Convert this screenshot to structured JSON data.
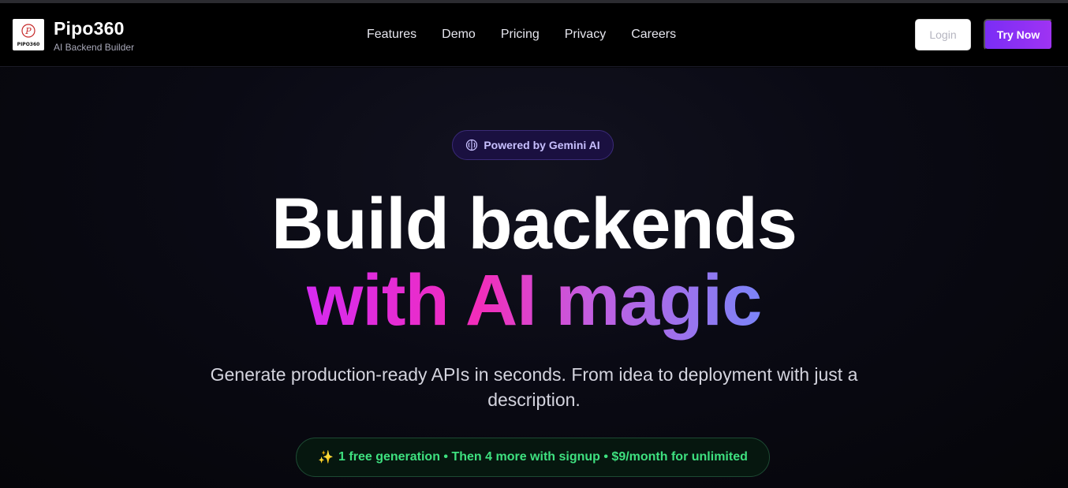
{
  "header": {
    "brand_name": "Pipo360",
    "brand_tagline": "AI Backend Builder",
    "logo_text": "PIPO360",
    "nav": [
      {
        "label": "Features"
      },
      {
        "label": "Demo"
      },
      {
        "label": "Pricing"
      },
      {
        "label": "Privacy"
      },
      {
        "label": "Careers"
      }
    ],
    "login_label": "Login",
    "try_label": "Try Now"
  },
  "hero": {
    "badge_label": "Powered by Gemini AI",
    "badge_icon": "brain-icon",
    "title_line1": "Build backends",
    "title_line2": "with AI magic",
    "description": "Generate production-ready APIs in seconds. From idea to deployment with just a description.",
    "offer_icon": "✨",
    "offer_text": "1 free generation • Then 4 more with signup • $9/month for unlimited"
  },
  "colors": {
    "accent_purple": "#7a2df5",
    "gradient_pink": "#f22dba",
    "gradient_blue": "#7b84f8",
    "offer_green": "#3ee07f"
  }
}
